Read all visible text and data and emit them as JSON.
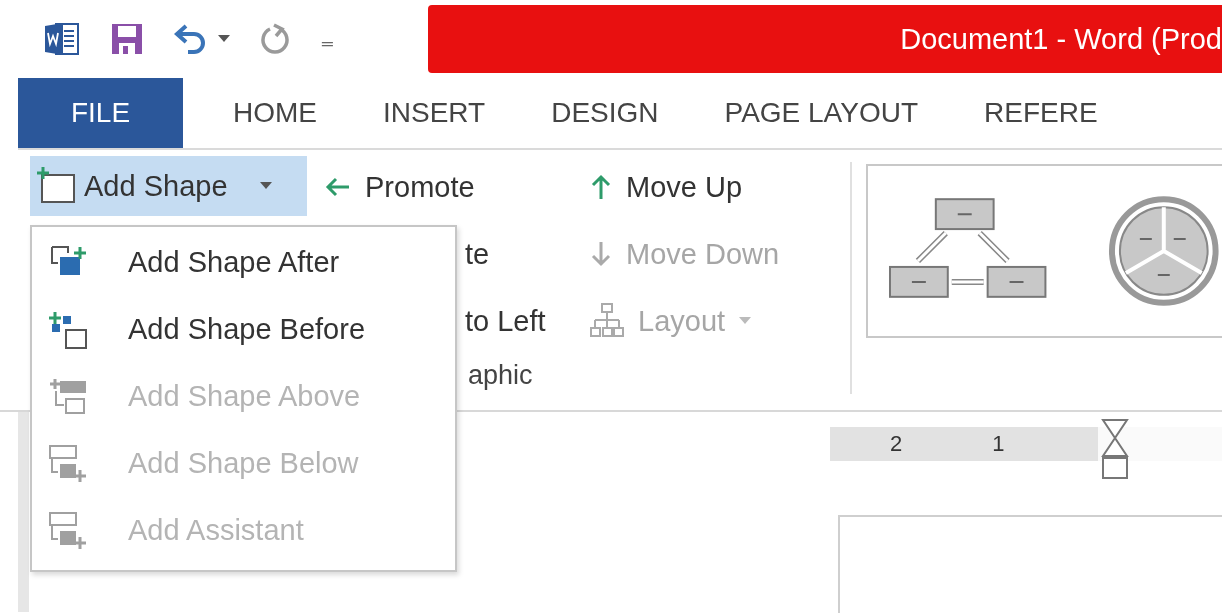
{
  "window": {
    "title": "Document1 -  Word (Prod"
  },
  "quick_access": {
    "customize_glyph": "₌"
  },
  "tabs": [
    {
      "label": "FILE",
      "kind": "file",
      "selected": false
    },
    {
      "label": "HOME",
      "kind": "tab",
      "selected": false
    },
    {
      "label": "INSERT",
      "kind": "tab",
      "selected": false
    },
    {
      "label": "DESIGN",
      "kind": "tab",
      "selected": false
    },
    {
      "label": "PAGE LAYOUT",
      "kind": "tab",
      "selected": false
    },
    {
      "label": "REFERE",
      "kind": "tab",
      "selected": false
    }
  ],
  "add_shape_button": {
    "label": "Add Shape",
    "expanded": true
  },
  "create_graphic": [
    {
      "label": "Promote",
      "kind": "promote"
    },
    {
      "label": "te",
      "kind": "covered"
    },
    {
      "label": "to Left",
      "kind": "covered"
    }
  ],
  "create_graphic_label": "aphic",
  "move_commands": [
    {
      "label": "Move Up",
      "kind": "up",
      "disabled": false
    },
    {
      "label": "Move Down",
      "kind": "down",
      "disabled": true
    },
    {
      "label": "Layout",
      "kind": "layout",
      "disabled": true
    }
  ],
  "add_shape_menu": [
    {
      "label": "Add Shape After",
      "kind": "after",
      "disabled": false
    },
    {
      "label": "Add Shape Before",
      "kind": "before",
      "disabled": false
    },
    {
      "label": "Add Shape Above",
      "kind": "above",
      "disabled": true
    },
    {
      "label": "Add Shape Below",
      "kind": "below",
      "disabled": true
    },
    {
      "label": "Add Assistant",
      "kind": "assistant",
      "disabled": true
    }
  ],
  "ruler": {
    "labels": [
      "2",
      "1"
    ]
  }
}
